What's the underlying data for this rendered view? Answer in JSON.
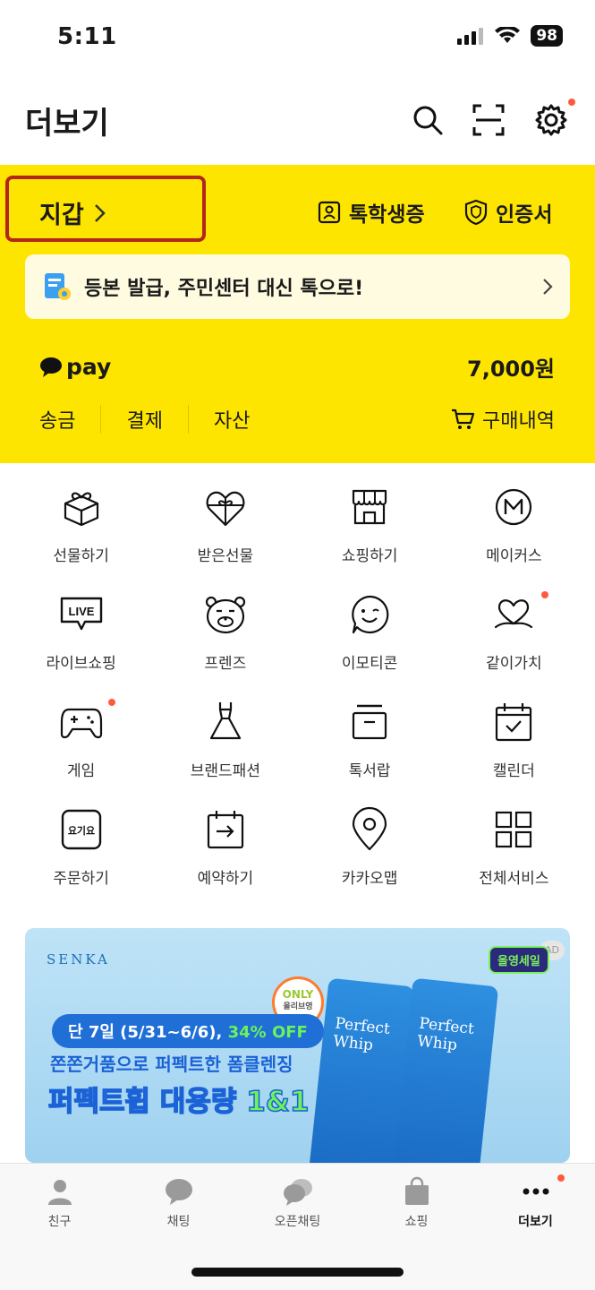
{
  "status": {
    "time": "5:11",
    "battery": "98"
  },
  "header": {
    "title": "더보기"
  },
  "wallet": {
    "title": "지갑",
    "student_id": "톡학생증",
    "certificate": "인증서",
    "banner_text": "등본 발급, 주민센터 대신 톡으로!",
    "pay_label": "pay",
    "pay_amount": "7,000원",
    "actions": [
      "송금",
      "결제",
      "자산"
    ],
    "purchase_history": "구매내역"
  },
  "services": [
    {
      "label": "선물하기",
      "icon": "gift-box-icon"
    },
    {
      "label": "받은선물",
      "icon": "heart-gift-icon"
    },
    {
      "label": "쇼핑하기",
      "icon": "store-icon"
    },
    {
      "label": "메이커스",
      "icon": "makers-icon"
    },
    {
      "label": "라이브쇼핑",
      "icon": "live-icon",
      "badge_text": "LIVE"
    },
    {
      "label": "프렌즈",
      "icon": "friends-character-icon"
    },
    {
      "label": "이모티콘",
      "icon": "emoticon-icon"
    },
    {
      "label": "같이가치",
      "icon": "together-heart-icon",
      "dot": true
    },
    {
      "label": "게임",
      "icon": "game-controller-icon",
      "dot": true
    },
    {
      "label": "브랜드패션",
      "icon": "dress-icon"
    },
    {
      "label": "톡서랍",
      "icon": "drawer-icon"
    },
    {
      "label": "캘린더",
      "icon": "calendar-icon"
    },
    {
      "label": "주문하기",
      "icon": "order-icon",
      "badge_text": "요기요"
    },
    {
      "label": "예약하기",
      "icon": "reservation-icon"
    },
    {
      "label": "카카오맵",
      "icon": "map-pin-icon"
    },
    {
      "label": "전체서비스",
      "icon": "all-services-icon"
    }
  ],
  "ad": {
    "brand": "SENKA",
    "ad_badge": "AD",
    "only_label": "ONLY",
    "only_sub": "올리브영",
    "period_prefix": "단 7일 (5/31~6/6), ",
    "period_highlight": "34% OFF",
    "line1": "쫀쫀거품으로 퍼펙트한 폼클렌징",
    "line2_prefix": "퍼펙트휩 ",
    "line2_highlight": "대용량 1&1",
    "tube_text": "Perfect Whip",
    "event_tag": "올영세일"
  },
  "tabs": [
    {
      "label": "친구",
      "icon": "person-icon"
    },
    {
      "label": "채팅",
      "icon": "chat-bubble-icon"
    },
    {
      "label": "오픈채팅",
      "icon": "open-chat-icon"
    },
    {
      "label": "쇼핑",
      "icon": "shopping-bag-icon"
    },
    {
      "label": "더보기",
      "icon": "more-dots-icon",
      "active": true,
      "dot": true
    }
  ],
  "colors": {
    "kakao_yellow": "#fee500",
    "highlight_red": "#b3261e",
    "notif_dot": "#ff5a3d"
  }
}
